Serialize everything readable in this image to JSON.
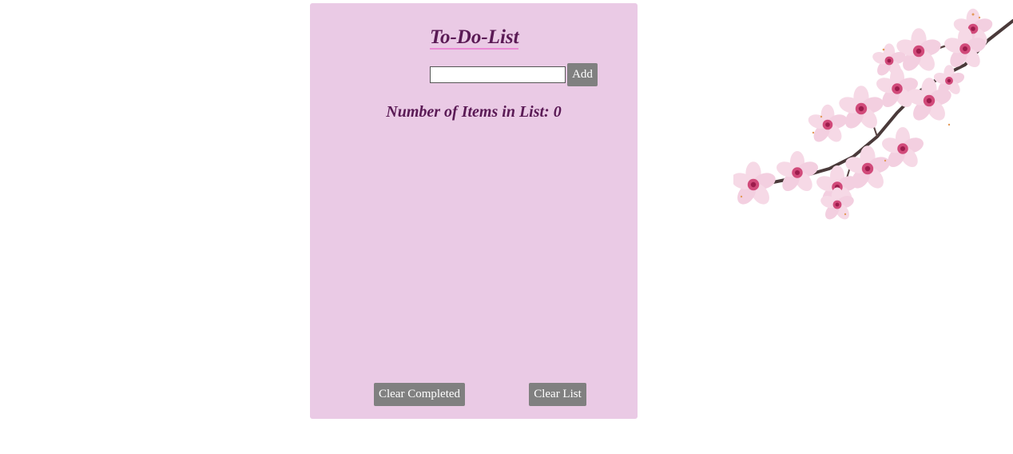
{
  "app": {
    "title": "To-Do-List",
    "input": {
      "value": "",
      "placeholder": ""
    },
    "add_label": "Add",
    "count_label": "Number of Items in List: ",
    "count_value": "0",
    "items": [],
    "clear_completed_label": "Clear Completed",
    "clear_list_label": "Clear List"
  },
  "decoration": {
    "image": "cherry-blossom-branch"
  },
  "colors": {
    "panel_bg": "#eacae5",
    "heading": "#5a1a55",
    "title_underline": "#e98ad4",
    "button_bg": "#808080",
    "button_text": "#ffffff"
  }
}
